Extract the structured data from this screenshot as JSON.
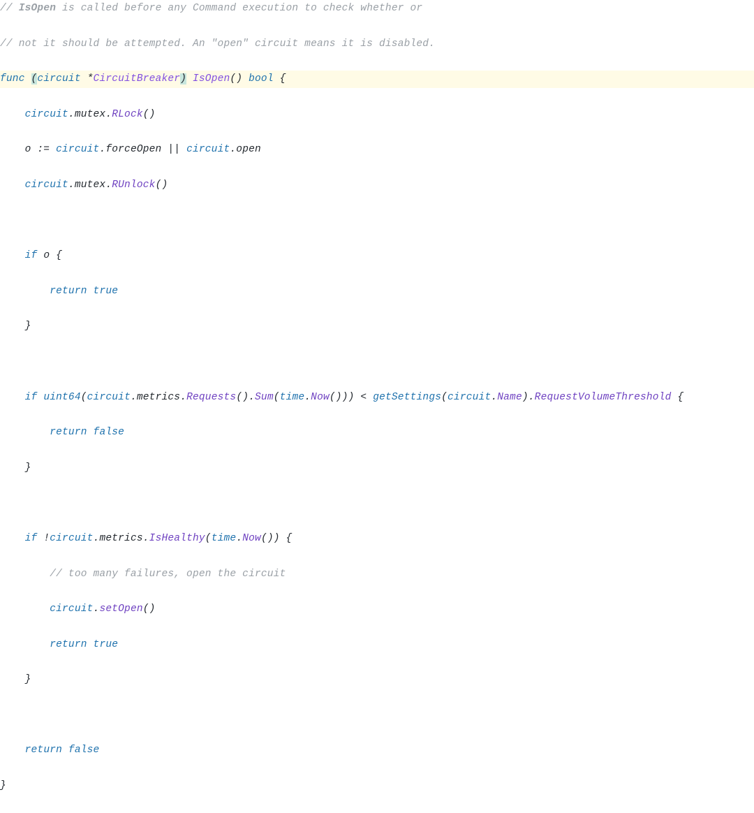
{
  "code": {
    "lines": [
      {
        "hl": false,
        "tokens": [
          {
            "t": "// ",
            "cls": "c-comment"
          },
          {
            "t": "IsOpen",
            "cls": "c-comment",
            "bold": true
          },
          {
            "t": " is called before any Command execution to check whether or",
            "cls": "c-comment"
          }
        ]
      },
      {
        "hl": false,
        "tokens": [
          {
            "t": "// not it should be attempted. An \"open\" circuit means it is disabled.",
            "cls": "c-comment"
          }
        ]
      },
      {
        "hl": true,
        "tokens": [
          {
            "t": "func",
            "cls": "c-kw"
          },
          {
            "t": " ",
            "cls": "c-text"
          },
          {
            "t": "(",
            "cls": "c-punc c-highlight-paren"
          },
          {
            "t": "circuit",
            "cls": "c-ident"
          },
          {
            "t": " *",
            "cls": "c-text"
          },
          {
            "t": "CircuitBreaker",
            "cls": "c-typename"
          },
          {
            "t": ")",
            "cls": "c-punc c-highlight-paren"
          },
          {
            "t": " ",
            "cls": "c-text"
          },
          {
            "t": "IsOpen",
            "cls": "c-funcname"
          },
          {
            "t": "()",
            "cls": "c-punc"
          },
          {
            "t": " ",
            "cls": "c-text"
          },
          {
            "t": "bool",
            "cls": "c-type"
          },
          {
            "t": " {",
            "cls": "c-text"
          }
        ]
      },
      {
        "hl": false,
        "tokens": [
          {
            "t": "    ",
            "cls": "c-text"
          },
          {
            "t": "circuit",
            "cls": "c-ident"
          },
          {
            "t": ".",
            "cls": "c-punc"
          },
          {
            "t": "mutex",
            "cls": "c-text"
          },
          {
            "t": ".",
            "cls": "c-punc"
          },
          {
            "t": "RLock",
            "cls": "c-member"
          },
          {
            "t": "()",
            "cls": "c-punc"
          }
        ]
      },
      {
        "hl": false,
        "tokens": [
          {
            "t": "    o := ",
            "cls": "c-text"
          },
          {
            "t": "circuit",
            "cls": "c-ident"
          },
          {
            "t": ".",
            "cls": "c-punc"
          },
          {
            "t": "forceOpen",
            "cls": "c-text"
          },
          {
            "t": " || ",
            "cls": "c-text"
          },
          {
            "t": "circuit",
            "cls": "c-ident"
          },
          {
            "t": ".",
            "cls": "c-punc"
          },
          {
            "t": "open",
            "cls": "c-text"
          }
        ]
      },
      {
        "hl": false,
        "tokens": [
          {
            "t": "    ",
            "cls": "c-text"
          },
          {
            "t": "circuit",
            "cls": "c-ident"
          },
          {
            "t": ".",
            "cls": "c-punc"
          },
          {
            "t": "mutex",
            "cls": "c-text"
          },
          {
            "t": ".",
            "cls": "c-punc"
          },
          {
            "t": "RUnlock",
            "cls": "c-member"
          },
          {
            "t": "()",
            "cls": "c-punc"
          }
        ]
      },
      {
        "hl": false,
        "tokens": [
          {
            "t": " ",
            "cls": "c-text"
          }
        ]
      },
      {
        "hl": false,
        "tokens": [
          {
            "t": "    ",
            "cls": "c-text"
          },
          {
            "t": "if",
            "cls": "c-kw"
          },
          {
            "t": " o {",
            "cls": "c-text"
          }
        ]
      },
      {
        "hl": false,
        "tokens": [
          {
            "t": "        ",
            "cls": "c-text"
          },
          {
            "t": "return",
            "cls": "c-kw"
          },
          {
            "t": " ",
            "cls": "c-text"
          },
          {
            "t": "true",
            "cls": "c-bool"
          }
        ]
      },
      {
        "hl": false,
        "tokens": [
          {
            "t": "    }",
            "cls": "c-text"
          }
        ]
      },
      {
        "hl": false,
        "tokens": [
          {
            "t": " ",
            "cls": "c-text"
          }
        ]
      },
      {
        "hl": false,
        "tokens": [
          {
            "t": "    ",
            "cls": "c-text"
          },
          {
            "t": "if",
            "cls": "c-kw"
          },
          {
            "t": " ",
            "cls": "c-text"
          },
          {
            "t": "uint64",
            "cls": "c-ident"
          },
          {
            "t": "(",
            "cls": "c-punc"
          },
          {
            "t": "circuit",
            "cls": "c-ident"
          },
          {
            "t": ".",
            "cls": "c-punc"
          },
          {
            "t": "metrics",
            "cls": "c-text"
          },
          {
            "t": ".",
            "cls": "c-punc"
          },
          {
            "t": "Requests",
            "cls": "c-member"
          },
          {
            "t": "().",
            "cls": "c-punc"
          },
          {
            "t": "Sum",
            "cls": "c-member"
          },
          {
            "t": "(",
            "cls": "c-punc"
          },
          {
            "t": "time",
            "cls": "c-ident"
          },
          {
            "t": ".",
            "cls": "c-punc"
          },
          {
            "t": "Now",
            "cls": "c-member"
          },
          {
            "t": "())) < ",
            "cls": "c-text"
          },
          {
            "t": "getSettings",
            "cls": "c-ident"
          },
          {
            "t": "(",
            "cls": "c-punc"
          },
          {
            "t": "circuit",
            "cls": "c-ident"
          },
          {
            "t": ".",
            "cls": "c-punc"
          },
          {
            "t": "Name",
            "cls": "c-member"
          },
          {
            "t": ").",
            "cls": "c-punc"
          },
          {
            "t": "RequestVolumeThreshold",
            "cls": "c-member"
          },
          {
            "t": " {",
            "cls": "c-text"
          }
        ]
      },
      {
        "hl": false,
        "tokens": [
          {
            "t": "        ",
            "cls": "c-text"
          },
          {
            "t": "return",
            "cls": "c-kw"
          },
          {
            "t": " ",
            "cls": "c-text"
          },
          {
            "t": "false",
            "cls": "c-bool"
          }
        ]
      },
      {
        "hl": false,
        "tokens": [
          {
            "t": "    }",
            "cls": "c-text"
          }
        ]
      },
      {
        "hl": false,
        "tokens": [
          {
            "t": " ",
            "cls": "c-text"
          }
        ]
      },
      {
        "hl": false,
        "tokens": [
          {
            "t": "    ",
            "cls": "c-text"
          },
          {
            "t": "if",
            "cls": "c-kw"
          },
          {
            "t": " !",
            "cls": "c-text"
          },
          {
            "t": "circuit",
            "cls": "c-ident"
          },
          {
            "t": ".",
            "cls": "c-punc"
          },
          {
            "t": "metrics",
            "cls": "c-text"
          },
          {
            "t": ".",
            "cls": "c-punc"
          },
          {
            "t": "IsHealthy",
            "cls": "c-member"
          },
          {
            "t": "(",
            "cls": "c-punc"
          },
          {
            "t": "time",
            "cls": "c-ident"
          },
          {
            "t": ".",
            "cls": "c-punc"
          },
          {
            "t": "Now",
            "cls": "c-member"
          },
          {
            "t": "()) {",
            "cls": "c-text"
          }
        ]
      },
      {
        "hl": false,
        "tokens": [
          {
            "t": "        ",
            "cls": "c-text"
          },
          {
            "t": "// too many failures, open the circuit",
            "cls": "c-comment"
          }
        ]
      },
      {
        "hl": false,
        "tokens": [
          {
            "t": "        ",
            "cls": "c-text"
          },
          {
            "t": "circuit",
            "cls": "c-ident"
          },
          {
            "t": ".",
            "cls": "c-punc"
          },
          {
            "t": "setOpen",
            "cls": "c-member"
          },
          {
            "t": "()",
            "cls": "c-punc"
          }
        ]
      },
      {
        "hl": false,
        "tokens": [
          {
            "t": "        ",
            "cls": "c-text"
          },
          {
            "t": "return",
            "cls": "c-kw"
          },
          {
            "t": " ",
            "cls": "c-text"
          },
          {
            "t": "true",
            "cls": "c-bool"
          }
        ]
      },
      {
        "hl": false,
        "tokens": [
          {
            "t": "    }",
            "cls": "c-text"
          }
        ]
      },
      {
        "hl": false,
        "tokens": [
          {
            "t": " ",
            "cls": "c-text"
          }
        ]
      },
      {
        "hl": false,
        "tokens": [
          {
            "t": "    ",
            "cls": "c-text"
          },
          {
            "t": "return",
            "cls": "c-kw"
          },
          {
            "t": " ",
            "cls": "c-text"
          },
          {
            "t": "false",
            "cls": "c-bool"
          }
        ]
      },
      {
        "hl": false,
        "tokens": [
          {
            "t": "}",
            "cls": "c-text"
          }
        ]
      }
    ]
  }
}
